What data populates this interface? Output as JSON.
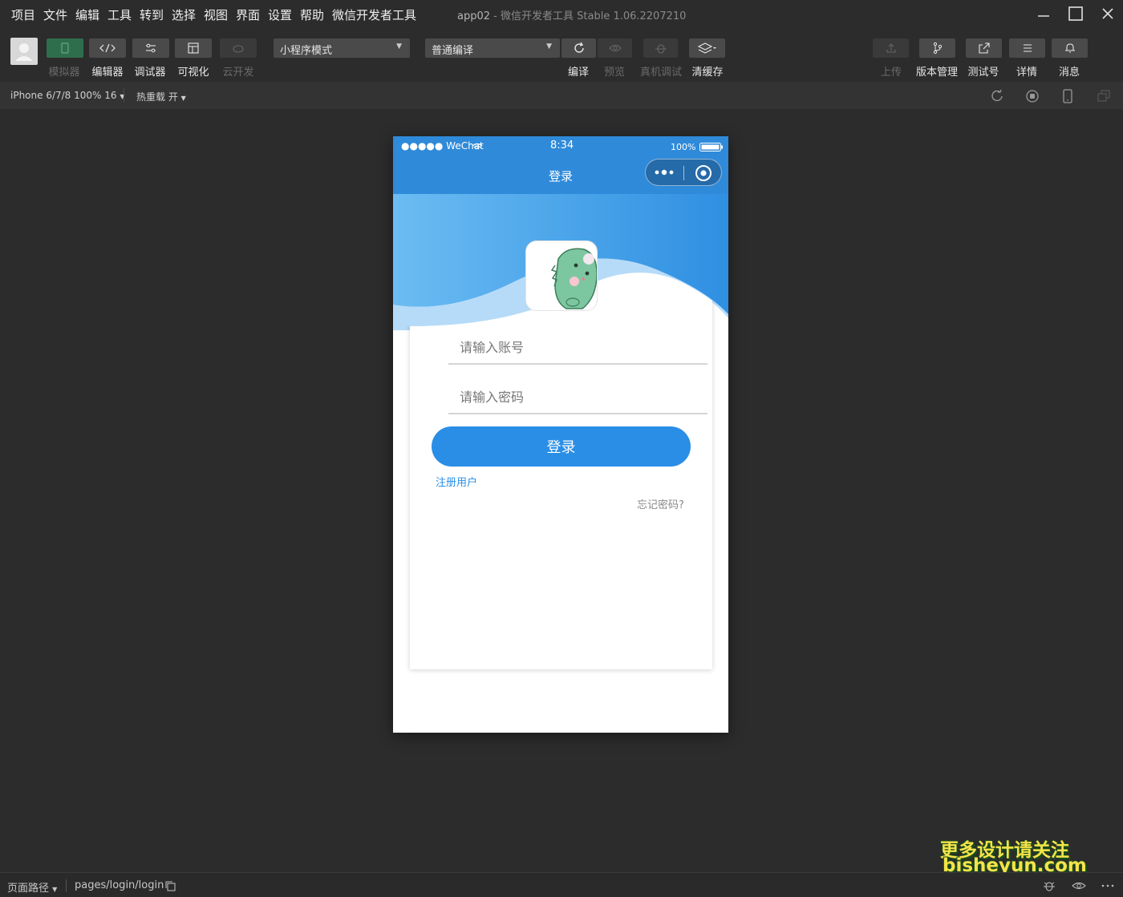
{
  "menu": {
    "items": [
      "项目",
      "文件",
      "编辑",
      "工具",
      "转到",
      "选择",
      "视图",
      "界面",
      "设置",
      "帮助",
      "微信开发者工具"
    ]
  },
  "window": {
    "app_name": "app02",
    "separator": "-",
    "tool_title": "微信开发者工具 Stable 1.06.2207210"
  },
  "toolbar": {
    "left_buttons": [
      {
        "label": "模拟器",
        "icon": "phone-icon",
        "enabled": false
      },
      {
        "label": "编辑器",
        "icon": "code-icon",
        "enabled": true
      },
      {
        "label": "调试器",
        "icon": "debug-sliders-icon",
        "enabled": true
      },
      {
        "label": "可视化",
        "icon": "layout-icon",
        "enabled": true
      },
      {
        "label": "云开发",
        "icon": "cloud-icon",
        "enabled": false
      }
    ],
    "mode_select": "小程序模式",
    "compile_select": "普通编译",
    "center_buttons": [
      {
        "label": "编译",
        "icon": "refresh-icon",
        "enabled": true
      },
      {
        "label": "预览",
        "icon": "eye-icon",
        "enabled": false
      },
      {
        "label": "真机调试",
        "icon": "bug-icon",
        "enabled": false
      },
      {
        "label": "清缓存",
        "icon": "layers-icon",
        "enabled": true
      }
    ],
    "right_buttons": [
      {
        "label": "上传",
        "icon": "upload-icon",
        "enabled": false
      },
      {
        "label": "版本管理",
        "icon": "branch-icon",
        "enabled": true
      },
      {
        "label": "测试号",
        "icon": "external-link-icon",
        "enabled": true
      },
      {
        "label": "详情",
        "icon": "menu-lines-icon",
        "enabled": true
      },
      {
        "label": "消息",
        "icon": "bell-icon",
        "enabled": true
      }
    ]
  },
  "subbar": {
    "device": "iPhone 6/7/8 100% 16",
    "hot_reload": "热重载 开"
  },
  "phone": {
    "carrier": "●●●●● WeChat",
    "time": "8:34",
    "battery": "100%",
    "nav_title": "登录",
    "account_placeholder": "请输入账号",
    "password_placeholder": "请输入密码",
    "login_button": "登录",
    "register_link": "注册用户",
    "forgot_link": "忘记密码?"
  },
  "statusbar": {
    "path_label": "页面路径",
    "path_value": "pages/login/login"
  },
  "watermark": {
    "line1": "更多设计请关注",
    "line2": "bisheyun.com"
  },
  "colors": {
    "accent": "#2a8ee6",
    "nav_bar": "#2f8ad9",
    "ide_bg": "#2c2c2c"
  }
}
